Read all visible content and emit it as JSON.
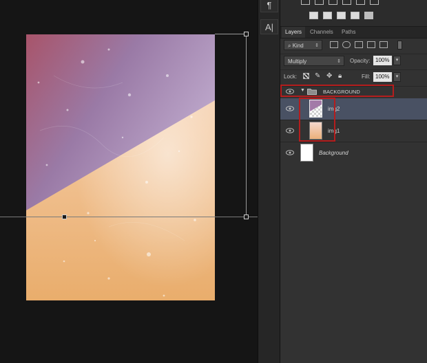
{
  "toolbar": {
    "paragraph_glyph": "¶",
    "character_glyph": "A|"
  },
  "adjustments": {
    "icons": [
      "brightness-contrast-icon",
      "levels-icon",
      "curves-icon",
      "exposure-icon",
      "vibrance-icon",
      "hue-saturation-icon",
      "color-balance-icon",
      "black-white-icon",
      "photo-filter-icon",
      "channel-mixer-icon",
      "color-lookup-icon",
      "invert-icon",
      "posterize-icon",
      "threshold-icon",
      "gradient-map-icon",
      "selective-color-icon"
    ]
  },
  "layers_panel": {
    "tabs": [
      {
        "label": "Layers",
        "active": true
      },
      {
        "label": "Channels",
        "active": false
      },
      {
        "label": "Paths",
        "active": false
      }
    ],
    "filter": {
      "value": "Kind"
    },
    "blend_mode": {
      "value": "Multiply"
    },
    "opacity": {
      "label": "Opacity:",
      "value": "100%"
    },
    "lock": {
      "label": "Lock:"
    },
    "fill": {
      "label": "Fill:",
      "value": "100%"
    },
    "layers": [
      {
        "name": "BACKGROUND",
        "type": "group",
        "expanded": true
      },
      {
        "name": "img2",
        "type": "layer",
        "selected": true
      },
      {
        "name": "img1",
        "type": "layer",
        "selected": false
      },
      {
        "name": "Background",
        "type": "background",
        "italic": true
      }
    ]
  },
  "colors": {
    "canvas_bg": "#151515",
    "panel_bg": "#323232",
    "selected_layer": "#495163",
    "highlight_box": "#b51d1d",
    "doc_purple": "#9f7eb2",
    "doc_orange": "#eab67a"
  }
}
